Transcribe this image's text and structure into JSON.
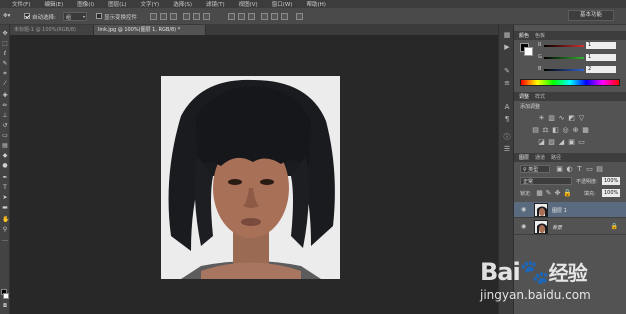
{
  "menubar": {
    "items": [
      "文件(F)",
      "编辑(E)",
      "图像(I)",
      "图层(L)",
      "文字(Y)",
      "选择(S)",
      "滤镜(T)",
      "视图(V)",
      "窗口(W)",
      "帮助(H)"
    ]
  },
  "options": {
    "auto_select_label": "自动选择:",
    "auto_select_value": "组",
    "transform_label": "显示变换控件",
    "workspace_label": "基本功能"
  },
  "tabs": [
    {
      "label": "未标题-1 @ 100%(RGB/8)",
      "active": false
    },
    {
      "label": "link.jpg @ 100%(图层 1, RGB/8) *",
      "active": true
    }
  ],
  "color_panel": {
    "tabs": [
      "颜色",
      "色板"
    ],
    "channels": [
      {
        "label": "R",
        "value": "1",
        "color": "#d23232"
      },
      {
        "label": "G",
        "value": "1",
        "color": "#32b432"
      },
      {
        "label": "B",
        "value": "2",
        "color": "#3264d2"
      }
    ]
  },
  "adjust_panel": {
    "tabs": [
      "调整",
      "样式"
    ],
    "subtitle": "添加调整"
  },
  "layers_panel": {
    "tabs": [
      "图层",
      "通道",
      "路径"
    ],
    "kind_label": "类型",
    "blend_mode": "正常",
    "opacity_label": "不透明度:",
    "opacity_value": "100%",
    "lock_label": "锁定:",
    "fill_label": "填充:",
    "fill_value": "100%",
    "layers": [
      {
        "name": "图层 1",
        "selected": true,
        "locked": false
      },
      {
        "name": "背景",
        "selected": false,
        "locked": true
      }
    ]
  },
  "watermark": {
    "brand": "Bai",
    "brand_suffix": "经验",
    "url": "jingyan.baidu.com"
  },
  "colors": {
    "accent_selected_layer": "#5a6b80",
    "canvas_bg": "#282828",
    "panel_bg": "#535353"
  }
}
